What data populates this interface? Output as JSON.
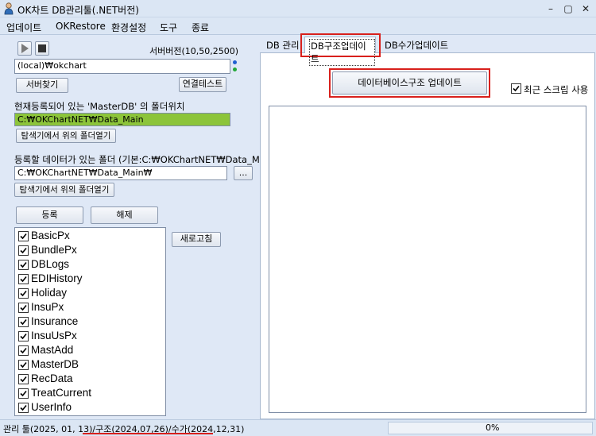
{
  "window": {
    "title": "OK차트 DB관리툴(.NET버전)",
    "minimize": "–",
    "restore": "▢",
    "close": "✕"
  },
  "menu": [
    "업데이트",
    "OKRestore",
    "환경설정",
    "도구",
    "종료"
  ],
  "left": {
    "server_version_label": "서버버전(10,50,2500)",
    "server_value": "(local)₩okchart",
    "find_server_button": "서버찾기",
    "test_connection_button": "연결테스트",
    "master_db_label": "현재등록되어 있는 'MasterDB' 의 폴더위치",
    "master_db_path": "C:₩OKChartNET₩Data_Main",
    "open_explorer_button_1": "탐색기에서 위의 폴더열기",
    "data_folder_label": "등록할 데이터가 있는 폴더 (기본:C:₩OKChartNET₩Data_Main)",
    "data_folder_path": "C:₩OKChartNET₩Data_Main₩",
    "browse_button": "...",
    "open_explorer_button_2": "탐색기에서 위의 폴더열기",
    "register_button": "등록",
    "unregister_button": "해제",
    "refresh_button": "새로고침",
    "db_list": [
      {
        "name": "BasicPx",
        "checked": true
      },
      {
        "name": "BundlePx",
        "checked": true
      },
      {
        "name": "DBLogs",
        "checked": true
      },
      {
        "name": "EDIHistory",
        "checked": true
      },
      {
        "name": "Holiday",
        "checked": true
      },
      {
        "name": "InsuPx",
        "checked": true
      },
      {
        "name": "Insurance",
        "checked": true
      },
      {
        "name": "InsuUsPx",
        "checked": true
      },
      {
        "name": "MastAdd",
        "checked": true
      },
      {
        "name": "MasterDB",
        "checked": true
      },
      {
        "name": "RecData",
        "checked": true
      },
      {
        "name": "TreatCurrent",
        "checked": true
      },
      {
        "name": "UserInfo",
        "checked": true
      }
    ]
  },
  "right": {
    "tabs": [
      "DB 관리",
      "DB구조업데이트",
      "DB수가업데이트"
    ],
    "active_tab": 1,
    "update_db_button": "데이터베이스구조 업데이트",
    "recent_script_label": "최근 스크립 사용",
    "recent_script_checked": true
  },
  "status": {
    "version_prefix": "관리 툴(2025, 01, 13)",
    "version_suffix": "/구조(2024,07,26)/수가(2024,12,31)",
    "progress_text": "0%",
    "progress_value": 0
  },
  "colors": {
    "highlight_red": "#d8201c",
    "master_path_green": "#8cc43a",
    "status_dot_blue": "#1f5fd1",
    "status_dot_green": "#22a838"
  }
}
